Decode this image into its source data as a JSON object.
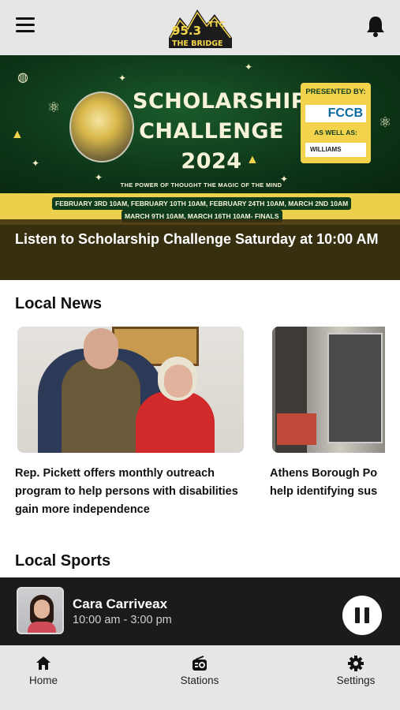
{
  "header": {
    "logo_text_top": "95.3",
    "logo_text_side": "TTC",
    "logo_text_bottom": "THE BRIDGE",
    "menu_icon": "hamburger-menu-icon",
    "notification_icon": "bell-icon"
  },
  "hero": {
    "title_line1": "SCHOLARSHIP",
    "title_line2": "CHALLENGE",
    "title_line3": "2024",
    "tagline": "THE POWER OF THOUGHT THE MAGIC OF THE MIND",
    "presented_by": "PRESENTED BY:",
    "sponsor1": "FCCB",
    "as_well_as": "AS WELL AS:",
    "sponsor2": "WILLIAMS",
    "dates_line1": "FEBRUARY 3RD 10AM, FEBRUARY 10TH 10AM, FEBRUARY 24TH 10AM, MARCH 2ND 10AM",
    "dates_line2": "MARCH 9TH 10AM, MARCH 16TH 10AM- FINALS",
    "caption": "Listen to Scholarship Challenge Saturday at 10:00 AM",
    "colors": {
      "green": "#0f3d1c",
      "yellow": "#ecd04c"
    }
  },
  "local_news": {
    "title": "Local News",
    "items": [
      {
        "headline": "Rep. Pickett offers monthly outreach program to help persons with disabilities gain more independence"
      },
      {
        "headline": "Athens Borough Po help identifying sus"
      }
    ]
  },
  "local_sports": {
    "title": "Local Sports"
  },
  "now_playing": {
    "host": "Cara Carriveax",
    "time": "10:00 am - 3:00 pm",
    "control_icon": "pause-icon"
  },
  "tabs": [
    {
      "label": "Home",
      "icon": "home-icon"
    },
    {
      "label": "Stations",
      "icon": "radio-icon"
    },
    {
      "label": "Settings",
      "icon": "gear-icon"
    }
  ]
}
